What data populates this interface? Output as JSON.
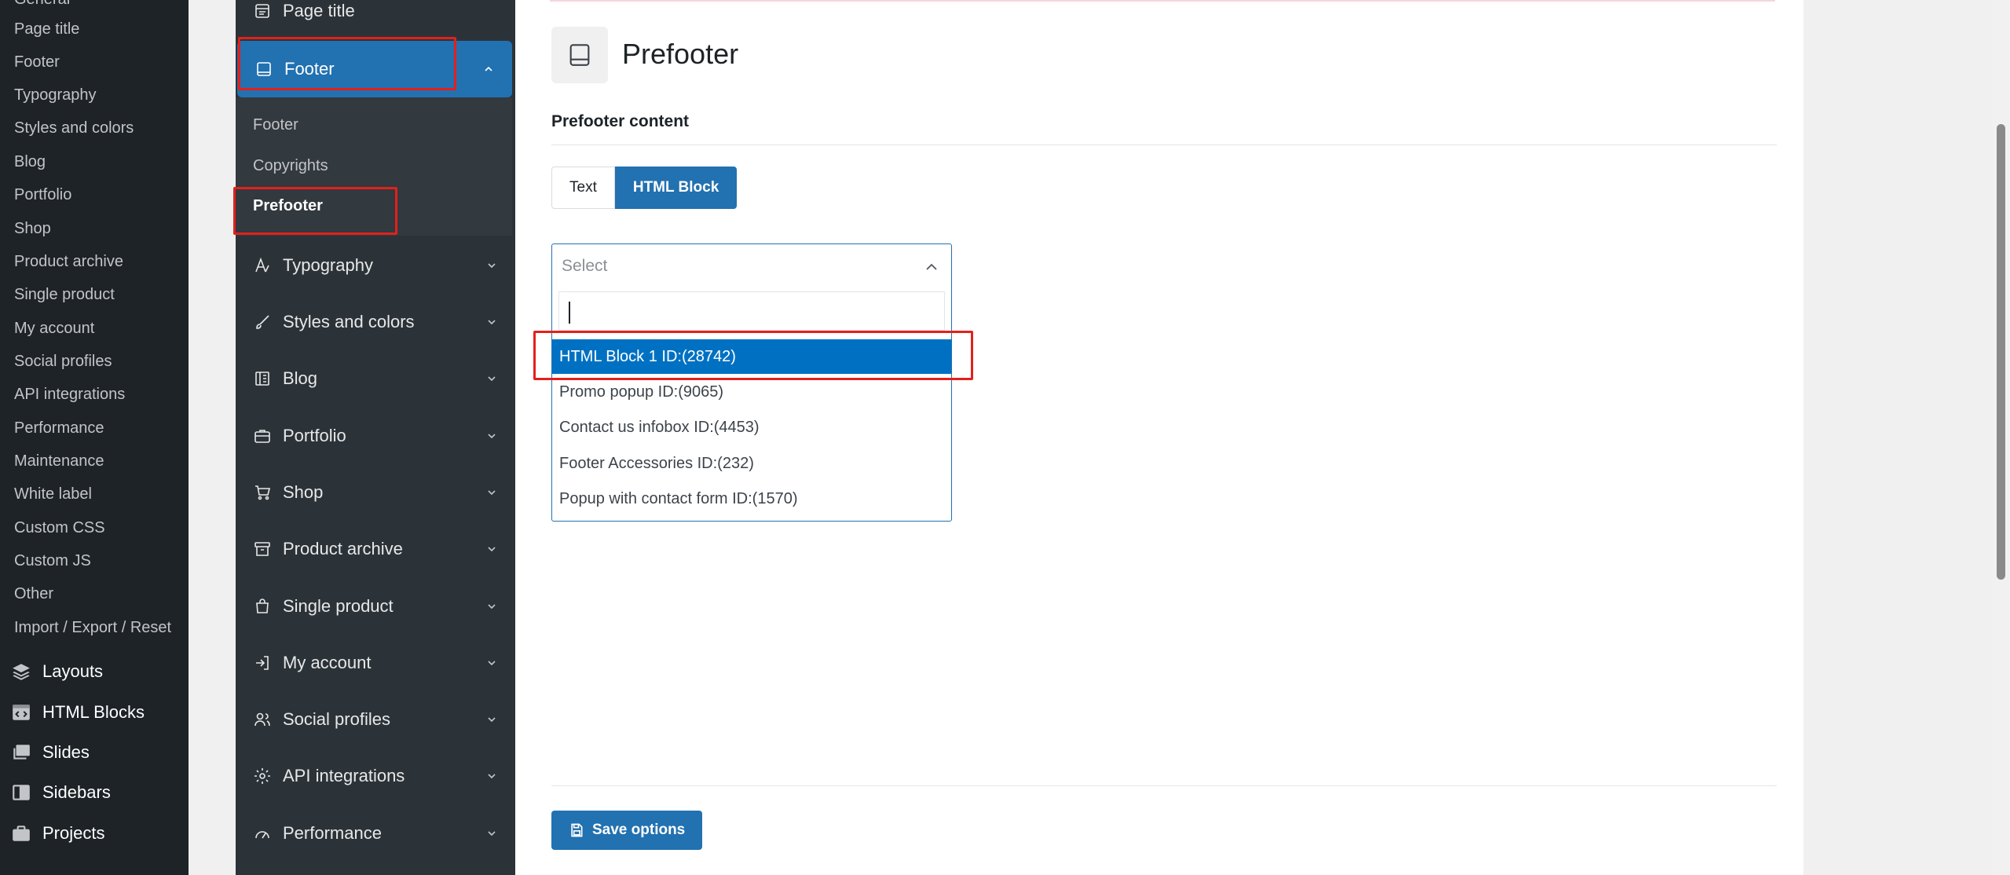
{
  "wp_sidebar": {
    "sub_items": [
      "General",
      "Page title",
      "Footer",
      "Typography",
      "Styles and colors",
      "Blog",
      "Portfolio",
      "Shop",
      "Product archive",
      "Single product",
      "My account",
      "Social profiles",
      "API integrations",
      "Performance",
      "Maintenance",
      "White label",
      "Custom CSS",
      "Custom JS",
      "Other",
      "Import / Export / Reset"
    ],
    "main_items": [
      {
        "label": "Layouts",
        "icon": "layers-icon"
      },
      {
        "label": "HTML Blocks",
        "icon": "code-block-icon"
      },
      {
        "label": "Slides",
        "icon": "slides-icon"
      },
      {
        "label": "Sidebars",
        "icon": "sidebar-icon"
      },
      {
        "label": "Projects",
        "icon": "briefcase-icon"
      }
    ]
  },
  "options_nav": {
    "page_title": "Page title",
    "footer": "Footer",
    "footer_sub": [
      "Footer",
      "Copyrights",
      "Prefooter"
    ],
    "sections": [
      "Typography",
      "Styles and colors",
      "Blog",
      "Portfolio",
      "Shop",
      "Product archive",
      "Single product",
      "My account",
      "Social profiles",
      "API integrations",
      "Performance"
    ]
  },
  "content": {
    "title": "Prefooter",
    "field_label": "Prefooter content",
    "toggle": {
      "text": "Text",
      "html": "HTML Block"
    },
    "select": {
      "placeholder": "Select",
      "options": [
        "HTML Block 1 ID:(28742)",
        "Promo popup ID:(9065)",
        "Contact us infobox ID:(4453)",
        "Footer Accessories ID:(232)",
        "Popup with contact form ID:(1570)"
      ]
    },
    "save_label": "Save options"
  },
  "colors": {
    "accent": "#2271b1",
    "highlight_option": "#0071c2",
    "annotation_red": "#e3201b",
    "sidebar_bg": "#1d2327",
    "nav_bg": "#2c3338"
  }
}
